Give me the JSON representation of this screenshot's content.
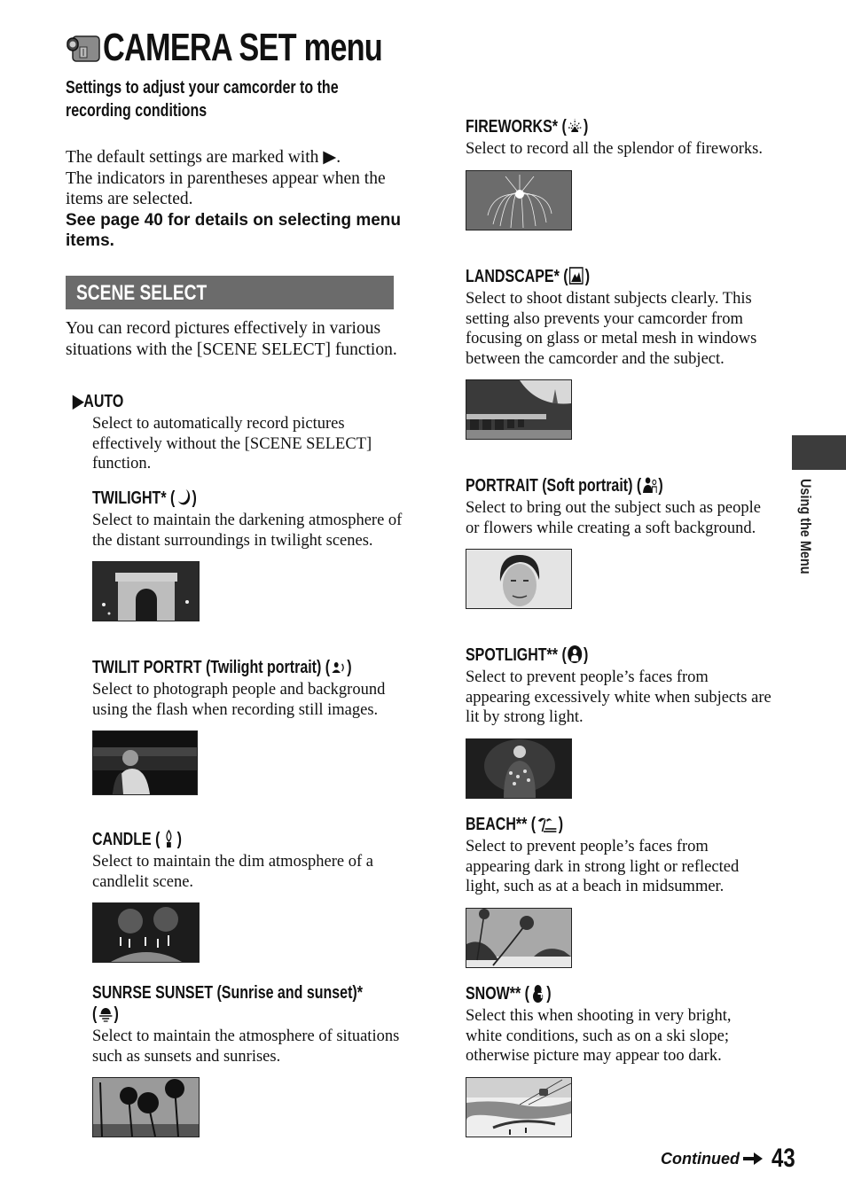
{
  "page": {
    "title": "CAMERA SET menu",
    "title_icon": "camcorder-icon",
    "subtitle_lines": [
      "Settings to adjust your camcorder to the",
      "recording conditions"
    ],
    "intro": {
      "line1": "The default settings are marked with ▶.",
      "line2": "The indicators in parentheses appear when the items are selected.",
      "bold": "See page 40 for details on selecting menu items."
    },
    "section": {
      "title": "SCENE SELECT",
      "lead": "You can record pictures effectively in various situations with the [SCENE SELECT] function."
    },
    "items_left": [
      {
        "head": "▶AUTO",
        "icon": null,
        "desc": "Select to automatically record pictures effectively without the [SCENE SELECT] function.",
        "photo": null
      },
      {
        "head": "TWILIGHT* (",
        "tail": ")",
        "icon": "moon-icon",
        "desc": "Select to maintain the darkening atmosphere of the distant surroundings in twilight scenes.",
        "photo": "arc-de-triomphe-night-photo"
      },
      {
        "head": "TWILIT PORTRT (Twilight portrait) (",
        "tail": ")",
        "icon": "twilight-portrait-icon",
        "desc": "Select to photograph people and background using the flash when recording still images.",
        "photo": "night-portrait-photo"
      },
      {
        "head": "CANDLE (",
        "tail": ")",
        "icon": "candle-icon",
        "desc": "Select to maintain the dim atmosphere of a candlelit scene.",
        "photo": "birthday-candles-photo"
      },
      {
        "head": "SUNRSE SUNSET (Sunrise and sunset)*",
        "head2": "(",
        "tail": ")",
        "icon": "sunset-icon",
        "desc": "Select to maintain the atmosphere of situations such as sunsets and sunrises.",
        "photo": "palm-silhouette-photo"
      }
    ],
    "items_right": [
      {
        "head": "FIREWORKS* (",
        "tail": ")",
        "icon": "fireworks-icon",
        "desc": "Select to record all the splendor of fireworks.",
        "photo": "fireworks-photo"
      },
      {
        "head": "LANDSCAPE* (",
        "tail": ")",
        "icon": "landscape-icon",
        "desc": "Select to shoot distant subjects clearly. This setting also prevents your camcorder from focusing on glass or metal mesh in windows between the camcorder and the subject.",
        "photo": "park-landscape-photo"
      },
      {
        "head": "PORTRAIT (Soft portrait) (",
        "tail": ")",
        "icon": "soft-portrait-icon",
        "desc": "Select to bring out the subject such as people or flowers while creating a soft background.",
        "photo": "woman-portrait-photo"
      },
      {
        "head": "SPOTLIGHT** (",
        "tail": ")",
        "icon": "spotlight-icon",
        "desc": "Select to prevent people’s faces from appearing excessively white when subjects are lit by strong light.",
        "photo": "stage-singer-photo"
      },
      {
        "head": "BEACH** (",
        "tail": ")",
        "icon": "beach-icon",
        "desc": "Select to prevent people’s faces from appearing dark in strong light or reflected light, such as at a beach in midsummer.",
        "photo": "beach-palms-photo"
      },
      {
        "head": "SNOW** (",
        "tail": ")",
        "icon": "snowman-icon",
        "desc": "Select this when shooting in very bright, white conditions, such as on a ski slope; otherwise picture may appear too dark.",
        "photo": "ski-slope-photo"
      }
    ],
    "side_tab": "Using the Menu",
    "footer": {
      "continued": "Continued",
      "page_number": "43"
    }
  }
}
